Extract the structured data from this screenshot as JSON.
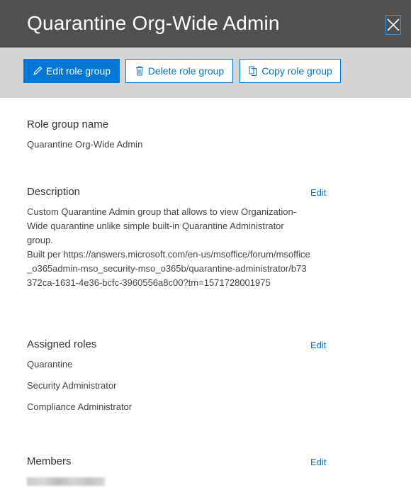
{
  "panel": {
    "title": "Quarantine Org-Wide Admin",
    "close_icon": "close-icon"
  },
  "toolbar": {
    "edit_label": "Edit role group",
    "delete_label": "Delete role group",
    "copy_label": "Copy role group",
    "edit_icon": "pencil-icon",
    "delete_icon": "trash-icon",
    "copy_icon": "copy-icon"
  },
  "role_group_name": {
    "label": "Role group name",
    "value": "Quarantine Org-Wide Admin"
  },
  "description": {
    "label": "Description",
    "edit_label": "Edit",
    "lines": [
      "Custom Quarantine Admin group that allows to view Organization-Wide quarantine unlike simple built-in Quarantine Administrator group.",
      "Built per https://answers.microsoft.com/en-us/msoffice/forum/msoffice_o365admin-mso_security-mso_o365b/quarantine-administrator/b73372ca-1631-4e36-bcfc-3960556a8c00?tm=1571728001975"
    ]
  },
  "assigned_roles": {
    "label": "Assigned roles",
    "edit_label": "Edit",
    "items": [
      "Quarantine",
      "Security Administrator",
      "Compliance Administrator"
    ]
  },
  "members": {
    "label": "Members",
    "edit_label": "Edit"
  },
  "colors": {
    "header_bg": "#505050",
    "toolbar_bg": "#d4d4d4",
    "accent": "#0078d7",
    "link": "#0072c6"
  }
}
